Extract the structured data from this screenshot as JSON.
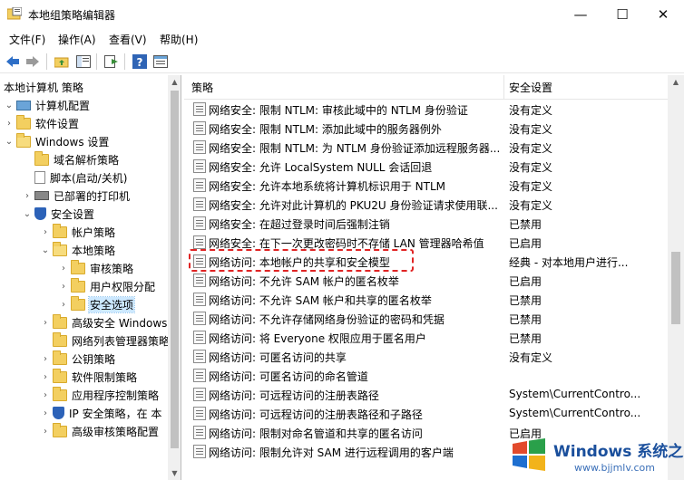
{
  "window": {
    "title": "本地组策略编辑器",
    "minimize": "—",
    "maximize": "☐",
    "close": "✕"
  },
  "menu": [
    "文件(F)",
    "操作(A)",
    "查看(V)",
    "帮助(H)"
  ],
  "toolbar": {
    "icons": [
      "back-icon",
      "forward-icon",
      "folder-up-icon",
      "console-tree-icon",
      "export-icon",
      "help-icon",
      "properties-icon"
    ]
  },
  "tree": {
    "root": "本地计算机 策略",
    "items": [
      {
        "label": "计算机配置",
        "icon": "monitor-icon",
        "chevron": ""
      },
      {
        "label": "软件设置",
        "icon": "folder-icon",
        "chevron": "›"
      },
      {
        "label": "Windows 设置",
        "icon": "folder-icon",
        "chevron": "⌄"
      },
      {
        "label": "域名解析策略",
        "icon": "chart-icon",
        "chevron": ""
      },
      {
        "label": "脚本(启动/关机)",
        "icon": "script-icon",
        "chevron": ""
      },
      {
        "label": "已部署的打印机",
        "icon": "printer-icon",
        "chevron": "›"
      },
      {
        "label": "安全设置",
        "icon": "shield-icon",
        "chevron": "⌄"
      },
      {
        "label": "帐户策略",
        "icon": "folder-icon",
        "chevron": "›"
      },
      {
        "label": "本地策略",
        "icon": "folder-icon",
        "chevron": "⌄"
      },
      {
        "label": "审核策略",
        "icon": "folder-icon",
        "chevron": "›"
      },
      {
        "label": "用户权限分配",
        "icon": "folder-icon",
        "chevron": "›"
      },
      {
        "label": "安全选项",
        "icon": "folder-icon",
        "chevron": "›"
      },
      {
        "label": "高级安全 Windows",
        "icon": "folder-icon",
        "chevron": "›"
      },
      {
        "label": "网络列表管理器策略",
        "icon": "folder-icon",
        "chevron": ""
      },
      {
        "label": "公钥策略",
        "icon": "folder-icon",
        "chevron": "›"
      },
      {
        "label": "软件限制策略",
        "icon": "folder-icon",
        "chevron": "›"
      },
      {
        "label": "应用程序控制策略",
        "icon": "folder-icon",
        "chevron": "›"
      },
      {
        "label": "IP 安全策略，在 本",
        "icon": "ipsec-icon",
        "chevron": "›"
      },
      {
        "label": "高级审核策略配置",
        "icon": "folder-icon",
        "chevron": "›"
      }
    ]
  },
  "table": {
    "headers": [
      "策略",
      "安全设置"
    ],
    "rows": [
      {
        "name": "网络安全: 限制 NTLM: 审核此域中的 NTLM 身份验证",
        "value": "没有定义"
      },
      {
        "name": "网络安全: 限制 NTLM: 添加此域中的服务器例外",
        "value": "没有定义"
      },
      {
        "name": "网络安全: 限制 NTLM: 为 NTLM 身份验证添加远程服务器...",
        "value": "没有定义"
      },
      {
        "name": "网络安全: 允许 LocalSystem NULL 会话回退",
        "value": "没有定义"
      },
      {
        "name": "网络安全: 允许本地系统将计算机标识用于 NTLM",
        "value": "没有定义"
      },
      {
        "name": "网络安全: 允许对此计算机的 PKU2U 身份验证请求使用联...",
        "value": "没有定义"
      },
      {
        "name": "网络安全: 在超过登录时间后强制注销",
        "value": "已禁用"
      },
      {
        "name": "网络安全: 在下一次更改密码时不存储 LAN 管理器哈希值",
        "value": "已启用"
      },
      {
        "name": "网络访问: 本地帐户的共享和安全模型",
        "value": "经典 - 对本地用户进行..."
      },
      {
        "name": "网络访问: 不允许 SAM 帐户的匿名枚举",
        "value": "已启用"
      },
      {
        "name": "网络访问: 不允许 SAM 帐户和共享的匿名枚举",
        "value": "已禁用"
      },
      {
        "name": "网络访问: 不允许存储网络身份验证的密码和凭据",
        "value": "已禁用"
      },
      {
        "name": "网络访问: 将 Everyone 权限应用于匿名用户",
        "value": "已禁用"
      },
      {
        "name": "网络访问: 可匿名访问的共享",
        "value": "没有定义"
      },
      {
        "name": "网络访问: 可匿名访问的命名管道",
        "value": ""
      },
      {
        "name": "网络访问: 可远程访问的注册表路径",
        "value": "System\\CurrentContro..."
      },
      {
        "name": "网络访问: 可远程访问的注册表路径和子路径",
        "value": "System\\CurrentContro..."
      },
      {
        "name": "网络访问: 限制对命名管道和共享的匿名访问",
        "value": "已启用"
      },
      {
        "name": "网络访问: 限制允许对 SAM 进行远程调用的客户端",
        "value": ""
      }
    ]
  },
  "watermark": {
    "title": "Windows 系统之家",
    "url": "www.bjjmlv.com"
  }
}
